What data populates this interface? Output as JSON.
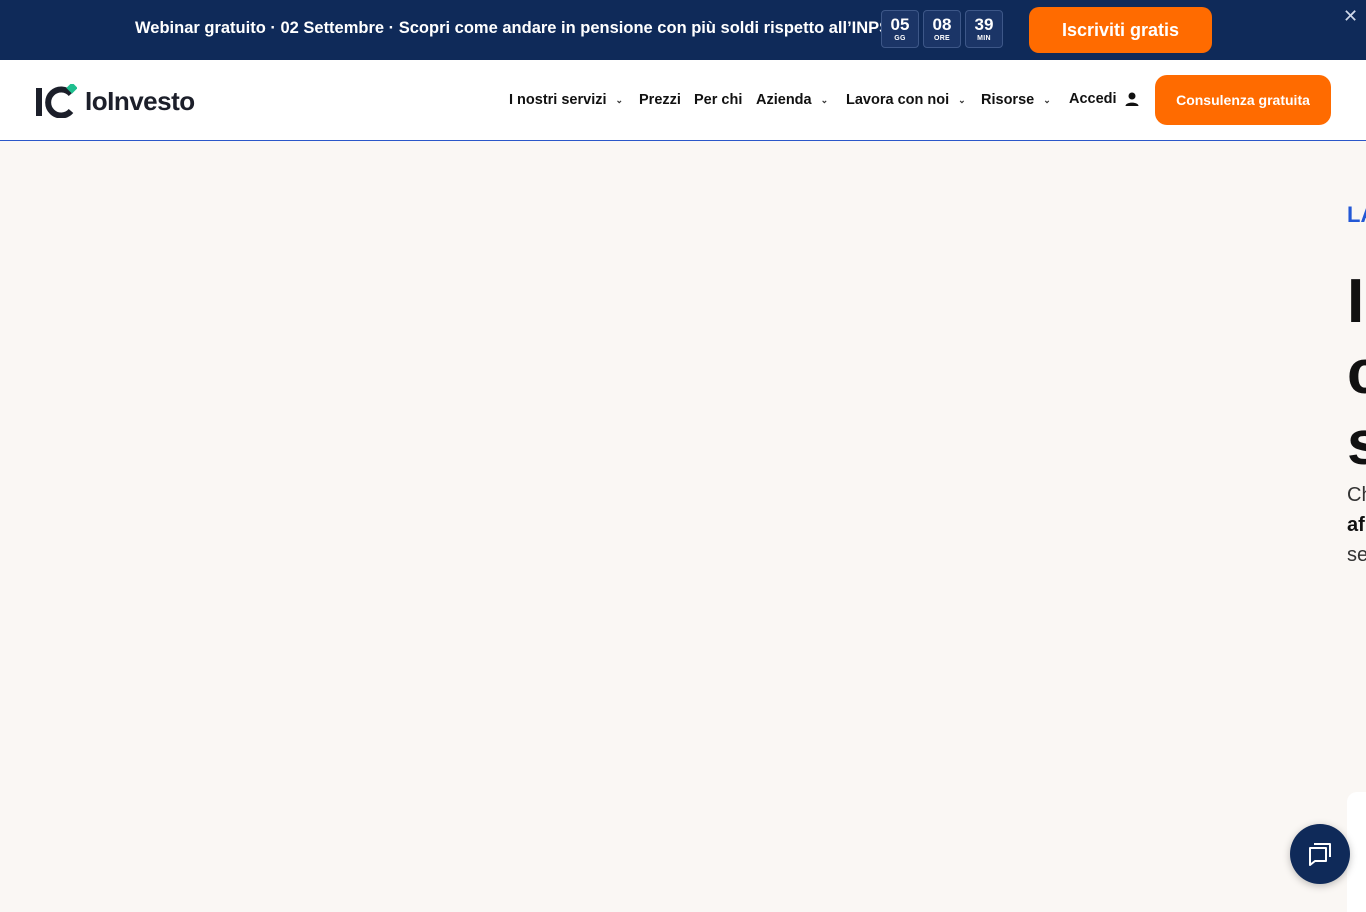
{
  "banner": {
    "text": "Webinar gratuito · 02 Settembre · Scopri come andare in pensione con più soldi rispetto all’INPS.",
    "countdown": [
      {
        "value": "05",
        "unit": "GG"
      },
      {
        "value": "08",
        "unit": "ORE"
      },
      {
        "value": "39",
        "unit": "MIN"
      }
    ],
    "cta_label": "Iscriviti gratis",
    "close_icon": "close-icon",
    "close_glyph": "✕"
  },
  "header": {
    "logo_text": "IoInvesto",
    "nav": [
      {
        "label": "I nostri servizi",
        "dropdown": true
      },
      {
        "label": "Prezzi",
        "dropdown": false
      },
      {
        "label": "Per chi",
        "dropdown": false
      },
      {
        "label": "Azienda",
        "dropdown": true
      },
      {
        "label": "Lavora con noi",
        "dropdown": true
      },
      {
        "label": "Risorse",
        "dropdown": true
      }
    ],
    "login_label": "Accedi",
    "cta_label": "Consulenza gratuita"
  },
  "hero": {
    "eyebrow": "LA IN",
    "title": "I c s",
    "subtitle_start": "Ch",
    "subtitle_bold": "af",
    "subtitle_end": "se"
  },
  "colors": {
    "banner_bg": "#0f2a59",
    "accent_orange": "#ff6b00",
    "accent_blue": "#2358d6",
    "logo_green": "#1fbf8f",
    "page_bg": "#faf7f4"
  },
  "icons": [
    "close-icon",
    "chevron-down-icon",
    "user-icon",
    "chat-icon"
  ]
}
